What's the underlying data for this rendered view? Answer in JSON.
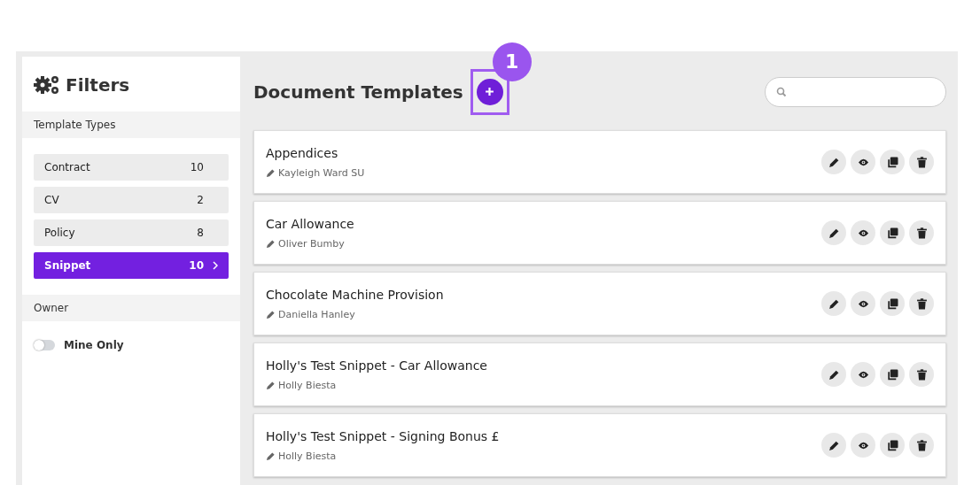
{
  "sidebar": {
    "title": "Filters",
    "sections": [
      {
        "heading": "Template Types"
      },
      {
        "heading": "Owner"
      }
    ],
    "template_types": [
      {
        "label": "Contract",
        "count": "10",
        "selected": false
      },
      {
        "label": "CV",
        "count": "2",
        "selected": false
      },
      {
        "label": "Policy",
        "count": "8",
        "selected": false
      },
      {
        "label": "Snippet",
        "count": "10",
        "selected": true
      }
    ],
    "mine_only": {
      "label": "Mine Only",
      "on": false
    }
  },
  "main": {
    "title": "Document Templates",
    "callout": "1",
    "templates": [
      {
        "name": "Appendices",
        "author": "Kayleigh Ward SU"
      },
      {
        "name": "Car Allowance",
        "author": "Oliver Bumby"
      },
      {
        "name": "Chocolate Machine Provision",
        "author": "Daniella Hanley"
      },
      {
        "name": "Holly's Test Snippet - Car Allowance",
        "author": "Holly Biesta"
      },
      {
        "name": "Holly's Test Snippet - Signing Bonus £",
        "author": "Holly Biesta"
      }
    ]
  }
}
